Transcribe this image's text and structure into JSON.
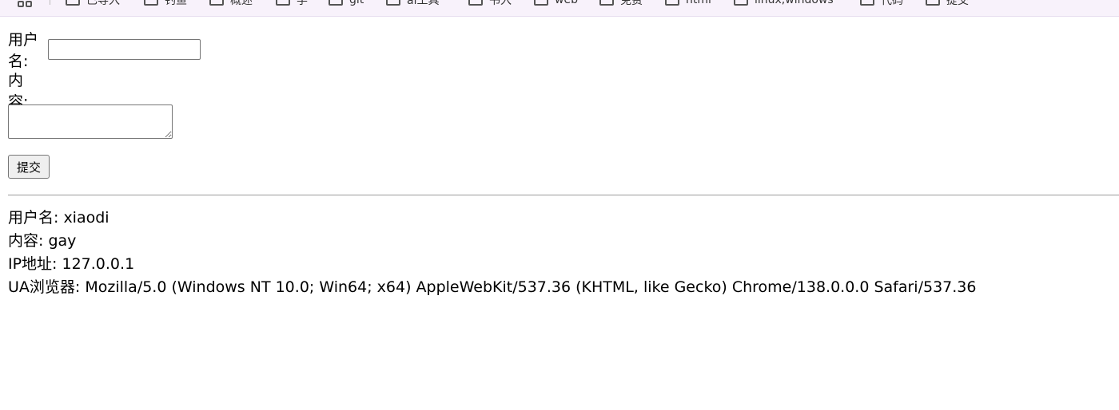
{
  "bookmarks": {
    "items": [
      {
        "label": "已导入"
      },
      {
        "label": "钓鱼"
      },
      {
        "label": "概述"
      },
      {
        "label": "学"
      },
      {
        "label": "git"
      },
      {
        "label": "ai工具"
      },
      {
        "label": "书入"
      },
      {
        "label": "web"
      },
      {
        "label": "免费"
      },
      {
        "label": "html"
      },
      {
        "label": "linux,windows"
      },
      {
        "label": "代码"
      },
      {
        "label": "提交"
      }
    ]
  },
  "form": {
    "username_label": "用户名:",
    "username_value": "",
    "content_label": "内容:",
    "content_value": "",
    "submit_label": "提交"
  },
  "result": {
    "username_line": "用户名: xiaodi",
    "content_line": "内容: gay",
    "ip_line": "IP地址: 127.0.0.1",
    "ua_line": "UA浏览器: Mozilla/5.0 (Windows NT 10.0; Win64; x64) AppleWebKit/537.36 (KHTML, like Gecko) Chrome/138.0.0.0 Safari/537.36"
  }
}
